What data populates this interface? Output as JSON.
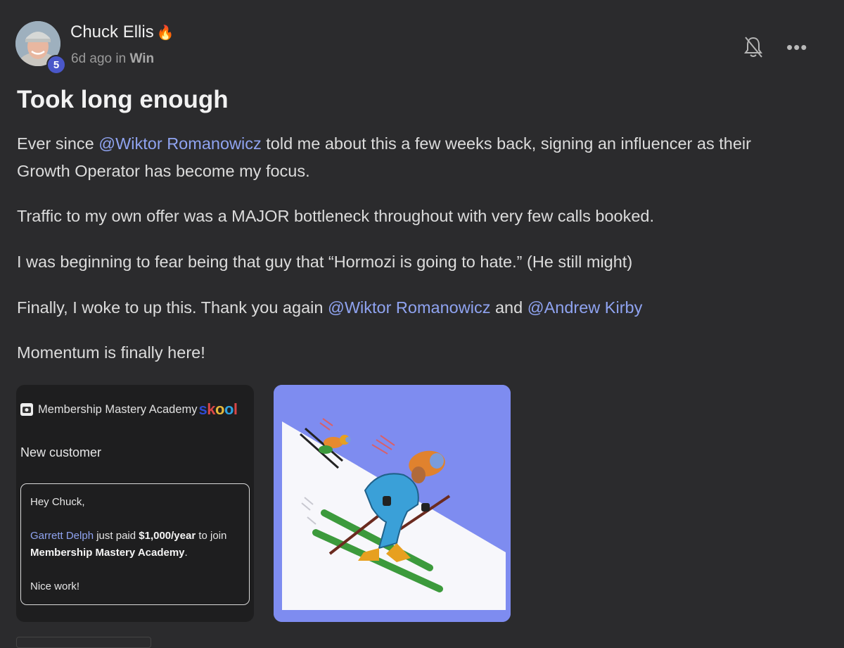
{
  "post": {
    "author": "Chuck Ellis",
    "author_emoji": "🔥",
    "level": "5",
    "time_ago": "6d ago in",
    "category": "Win",
    "title": "Took long enough",
    "paragraphs": [
      {
        "parts": [
          "Ever since ",
          "@Wiktor Romanowicz",
          " told me about this a few weeks back, signing an influencer as their"
        ]
      },
      {
        "text": "Growth Operator has become my focus."
      },
      {
        "text": "Traffic to my own offer was a MAJOR bottleneck throughout with very few calls booked."
      },
      {
        "text": "I was beginning to fear being that guy that “Hormozi is going to hate.” (He still might)"
      },
      {
        "parts": [
          "Finally, I woke to up this. Thank you again ",
          "@Wiktor Romanowicz",
          " and ",
          "@Andrew Kirby"
        ]
      },
      {
        "text": "Momentum is finally here!"
      }
    ]
  },
  "attachment_email": {
    "community": "Membership Mastery Academy",
    "brand": "skool",
    "label": "New customer",
    "greeting": "Hey Chuck,",
    "buyer": "Garrett Delph",
    "paid_text": " just paid ",
    "amount": "$1,000/year",
    "join_text": " to join ",
    "community_bold": "Membership Mastery Academy",
    "period": ".",
    "signoff": "Nice work!"
  },
  "icons": {
    "bell": "bell-off-icon",
    "more": "more-horizontal-icon",
    "community_logo": "community-logo-icon"
  },
  "colors": {
    "background": "#2b2b2d",
    "mention": "#8fa3f0",
    "level_badge": "#4a57c9",
    "illustration_bg": "#7e8cf0"
  }
}
